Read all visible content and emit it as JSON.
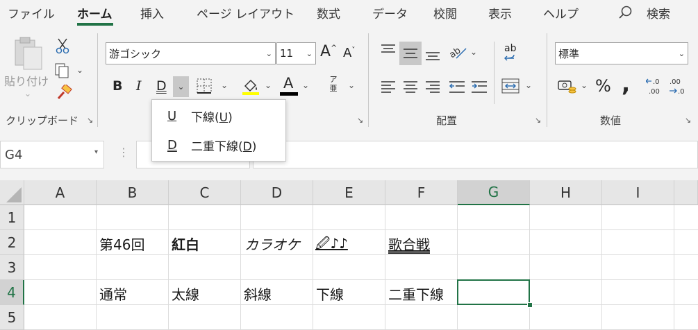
{
  "menu": {
    "tabs": [
      "ファイル",
      "ホーム",
      "挿入",
      "ページ レイアウト",
      "数式",
      "データ",
      "校閲",
      "表示",
      "ヘルプ"
    ],
    "active_tab": "ホーム",
    "search_label": "検索"
  },
  "ribbon": {
    "clipboard": {
      "paste_label": "貼り付け",
      "group_label": "クリップボード"
    },
    "font": {
      "font_name": "游ゴシック",
      "font_size": "11",
      "grow_label": "A",
      "shrink_label": "A",
      "bold": "B",
      "italic": "I",
      "underline": "D",
      "font_color_glyph": "A",
      "phonetic_top": "ア",
      "phonetic_bottom": "亜"
    },
    "alignment": {
      "group_label": "配置",
      "wrap_glyph": "ab"
    },
    "number": {
      "format": "標準",
      "group_label": "数値",
      "percent": "%",
      "comma": ",",
      "inc_decimal": "←.0 .00",
      "dec_decimal": ".00 →.0"
    }
  },
  "underline_menu": {
    "items": [
      {
        "icon": "U",
        "label": "下線(",
        "key": "U",
        "close": ")"
      },
      {
        "icon": "D",
        "label": "二重下線(",
        "key": "D",
        "close": ")"
      }
    ]
  },
  "formula_bar": {
    "name_box": "G4",
    "formula": ""
  },
  "grid": {
    "columns": [
      "A",
      "B",
      "C",
      "D",
      "E",
      "F",
      "G",
      "H",
      "I"
    ],
    "rows": [
      "1",
      "2",
      "3",
      "4",
      "5"
    ],
    "selected_cell": "G4",
    "cells": {
      "B2": "第46回",
      "C2": "紅白",
      "D2": "カラオケ",
      "E2": "🖉♪♪",
      "F2": "歌合戦",
      "B4": "通常",
      "C4": "太線",
      "D4": "斜線",
      "E4": "下線",
      "F4": "二重下線"
    }
  },
  "colors": {
    "accent": "#217346",
    "grid_line": "#dcdcdc",
    "header_bg": "#e6e6e6",
    "ribbon_bg": "#f3f3f3"
  }
}
